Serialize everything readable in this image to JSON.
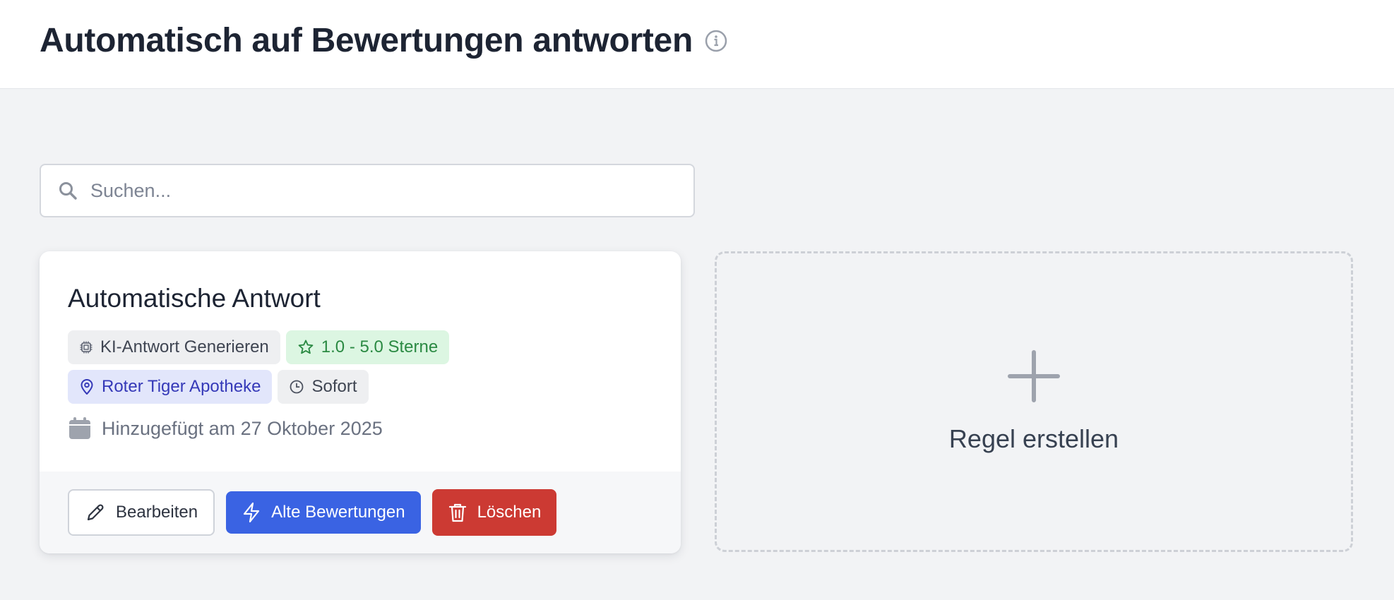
{
  "header": {
    "title": "Automatisch auf Bewertungen antworten"
  },
  "search": {
    "placeholder": "Suchen..."
  },
  "rule_card": {
    "title": "Automatische Antwort",
    "tags": {
      "ai": "KI-Antwort Generieren",
      "rating": "1.0 - 5.0 Sterne",
      "location": "Roter Tiger Apotheke",
      "timing": "Sofort"
    },
    "added": "Hinzugefügt am 27 Oktober 2025",
    "buttons": {
      "edit": "Bearbeiten",
      "old_reviews": "Alte Bewertungen",
      "delete": "Löschen"
    }
  },
  "create_card": {
    "label": "Regel erstellen"
  },
  "colors": {
    "primary": "#3a63e3",
    "danger": "#cc3a33",
    "tag_green_bg": "#dcf6e2",
    "tag_blue_bg": "#e2e6fb"
  }
}
